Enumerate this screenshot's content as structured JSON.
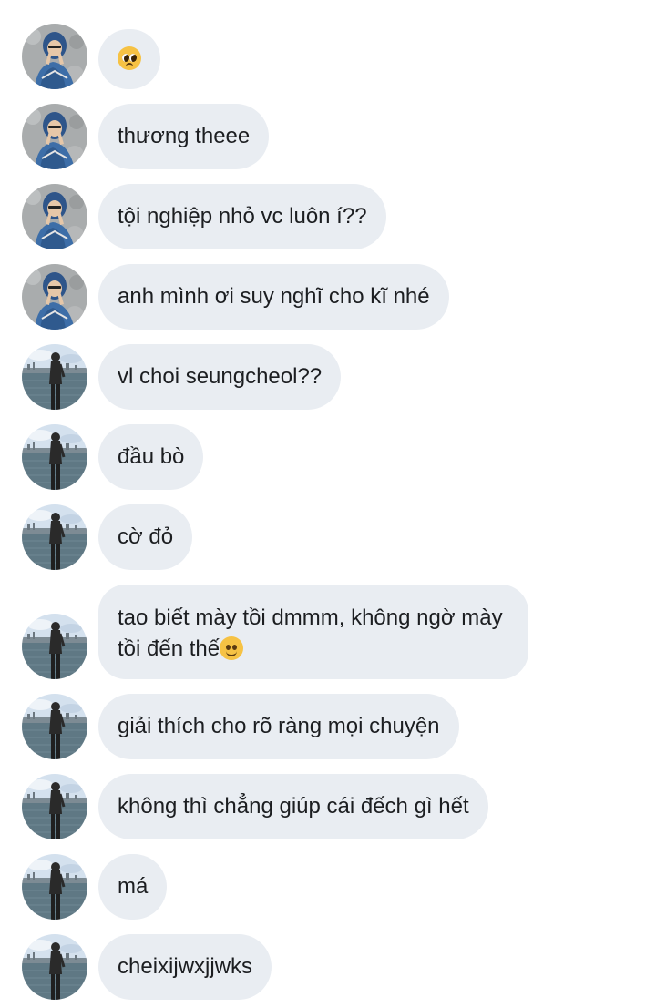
{
  "messages": [
    {
      "sender": "a",
      "emoji": "pleading-face-emoji",
      "text": ""
    },
    {
      "sender": "a",
      "text": "thương theee"
    },
    {
      "sender": "a",
      "text": "tội nghiệp nhỏ vc luôn í??"
    },
    {
      "sender": "a",
      "text": "anh mình ơi suy nghĩ cho kĩ nhé"
    },
    {
      "sender": "b",
      "text": "vl choi seungcheol??"
    },
    {
      "sender": "b",
      "text": "đầu bò"
    },
    {
      "sender": "b",
      "text": "cờ đỏ"
    },
    {
      "sender": "b",
      "text": "tao biết mày tồi dmmm, không ngờ mày tồi đến thế",
      "emoji": "slightly-smiling-face-emoji"
    },
    {
      "sender": "b",
      "text": "giải thích cho rõ ràng mọi chuyện"
    },
    {
      "sender": "b",
      "text": "không thì chẳng giúp cái đếch gì hết"
    },
    {
      "sender": "b",
      "text": "má"
    },
    {
      "sender": "b",
      "text": "cheixijwxjjwks"
    }
  ],
  "colors": {
    "bubble": "#e9edf2",
    "text": "#1c1e21",
    "background": "#ffffff"
  }
}
